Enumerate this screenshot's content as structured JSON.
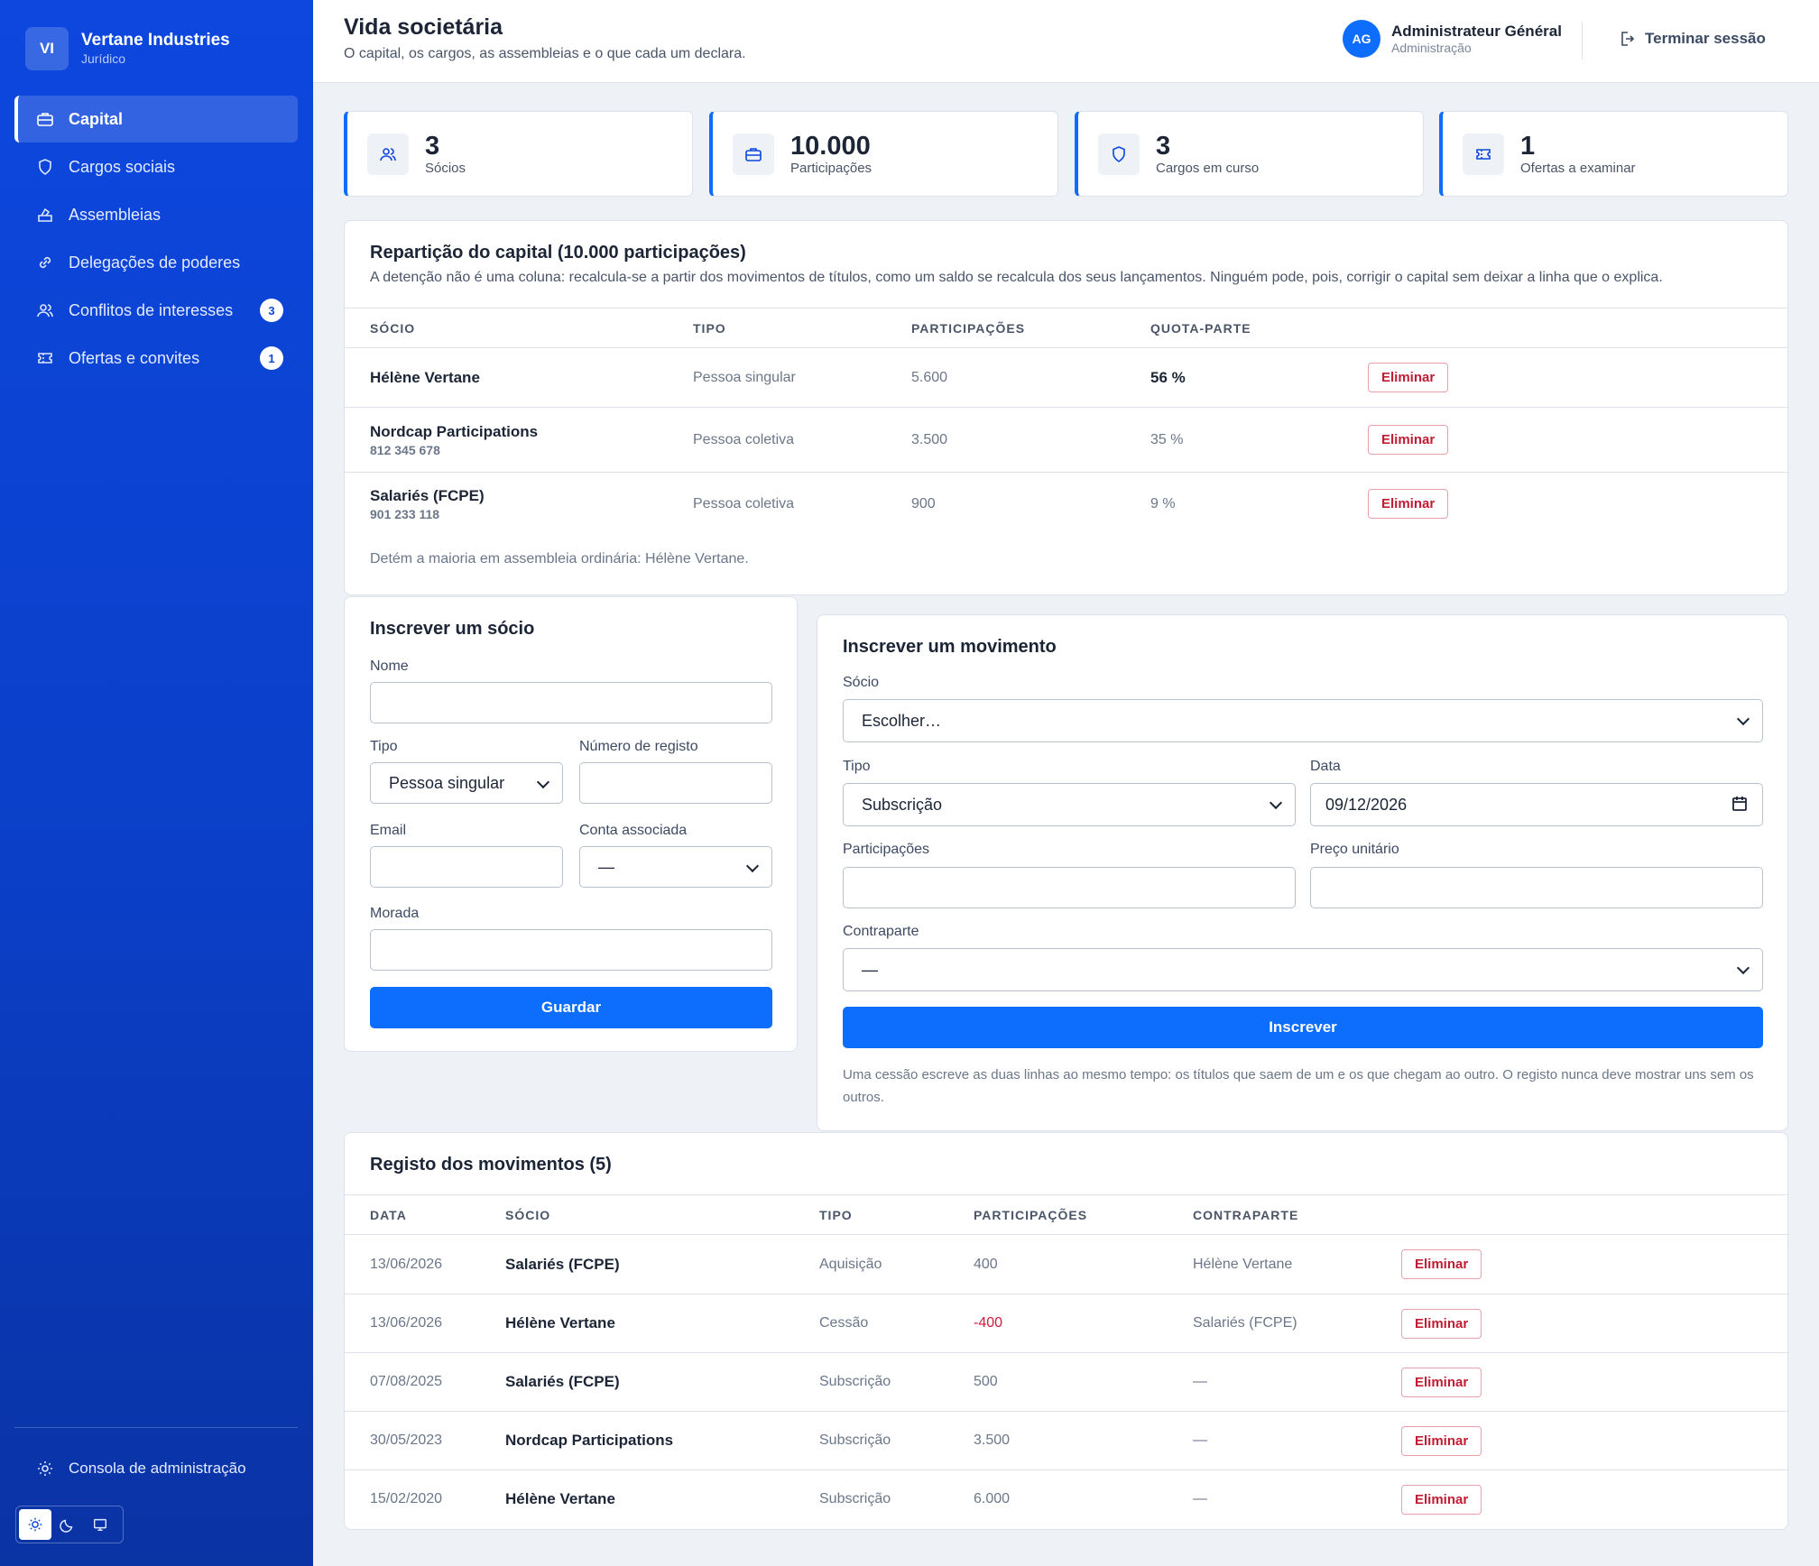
{
  "brand": {
    "initials": "VI",
    "name": "Vertane Industries",
    "sub": "Jurídico"
  },
  "nav": {
    "items": [
      {
        "label": "Capital",
        "icon": "briefcase-icon"
      },
      {
        "label": "Cargos sociais",
        "icon": "shield-icon"
      },
      {
        "label": "Assembleias",
        "icon": "ballot-icon"
      },
      {
        "label": "Delegações de poderes",
        "icon": "link-icon"
      },
      {
        "label": "Conflitos de interesses",
        "icon": "users-icon",
        "badge": "3"
      },
      {
        "label": "Ofertas e convites",
        "icon": "ticket-icon",
        "badge": "1"
      }
    ],
    "admin_console": "Consola de administração"
  },
  "header": {
    "title": "Vida societária",
    "subtitle": "O capital, os cargos, as assembleias e o que cada um declara.",
    "user_initials": "AG",
    "user_name": "Administrateur Général",
    "user_role": "Administração",
    "logout": "Terminar sessão"
  },
  "kpis": [
    {
      "value": "3",
      "label": "Sócios",
      "icon": "users-icon"
    },
    {
      "value": "10.000",
      "label": "Participações",
      "icon": "briefcase-icon"
    },
    {
      "value": "3",
      "label": "Cargos em curso",
      "icon": "shield-icon"
    },
    {
      "value": "1",
      "label": "Ofertas a examinar",
      "icon": "ticket-icon"
    }
  ],
  "capital": {
    "title": "Repartição do capital (10.000 participações)",
    "desc": "A detenção não é uma coluna: recalcula-se a partir dos movimentos de títulos, como um saldo se recalcula dos seus lançamentos. Ninguém pode, pois, corrigir o capital sem deixar a linha que o explica.",
    "columns": [
      "SÓCIO",
      "TIPO",
      "PARTICIPAÇÕES",
      "QUOTA-PARTE"
    ],
    "rows": [
      {
        "name": "Hélène Vertane",
        "reg": "",
        "type": "Pessoa singular",
        "shares": "5.600",
        "pct": "56 %"
      },
      {
        "name": "Nordcap Participations",
        "reg": "812 345 678",
        "type": "Pessoa coletiva",
        "shares": "3.500",
        "pct": "35 %"
      },
      {
        "name": "Salariés (FCPE)",
        "reg": "901 233 118",
        "type": "Pessoa coletiva",
        "shares": "900",
        "pct": "9 %"
      }
    ],
    "delete_label": "Eliminar",
    "footnote": "Detém a maioria em assembleia ordinária: Hélène Vertane."
  },
  "member_form": {
    "title": "Inscrever um sócio",
    "name_label": "Nome",
    "name_value": "",
    "type_label": "Tipo",
    "type_value": "Pessoa singular",
    "reg_label": "Número de registo",
    "reg_value": "",
    "email_label": "Email",
    "email_value": "",
    "account_label": "Conta associada",
    "account_value": "—",
    "address_label": "Morada",
    "address_value": "",
    "save": "Guardar"
  },
  "movement_form": {
    "title": "Inscrever um movimento",
    "member_label": "Sócio",
    "member_value": "Escolher…",
    "type_label": "Tipo",
    "type_value": "Subscrição",
    "date_label": "Data",
    "date_value": "09/12/2026",
    "shares_label": "Participações",
    "shares_value": "",
    "price_label": "Preço unitário",
    "price_value": "",
    "counterparty_label": "Contraparte",
    "counterparty_value": "—",
    "submit": "Inscrever",
    "note": "Uma cessão escreve as duas linhas ao mesmo tempo: os títulos que saem de um e os que chegam ao outro. O registo nunca deve mostrar uns sem os outros."
  },
  "movements": {
    "title": "Registo dos movimentos (5)",
    "columns": [
      "DATA",
      "SÓCIO",
      "TIPO",
      "PARTICIPAÇÕES",
      "CONTRAPARTE"
    ],
    "rows": [
      {
        "date": "13/06/2026",
        "member": "Salariés (FCPE)",
        "type": "Aquisição",
        "shares": "400",
        "counterparty": "Hélène Vertane",
        "negative": false
      },
      {
        "date": "13/06/2026",
        "member": "Hélène Vertane",
        "type": "Cessão",
        "shares": "-400",
        "counterparty": "Salariés (FCPE)",
        "negative": true
      },
      {
        "date": "07/08/2025",
        "member": "Salariés (FCPE)",
        "type": "Subscrição",
        "shares": "500",
        "counterparty": "—",
        "negative": false
      },
      {
        "date": "30/05/2023",
        "member": "Nordcap Participations",
        "type": "Subscrição",
        "shares": "3.500",
        "counterparty": "—",
        "negative": false
      },
      {
        "date": "15/02/2020",
        "member": "Hélène Vertane",
        "type": "Subscrição",
        "shares": "6.000",
        "counterparty": "—",
        "negative": false
      }
    ],
    "delete_label": "Eliminar"
  },
  "colors": {
    "primary": "#0d6efd",
    "sidebar": "#0d47de",
    "danger": "#c01c32"
  }
}
